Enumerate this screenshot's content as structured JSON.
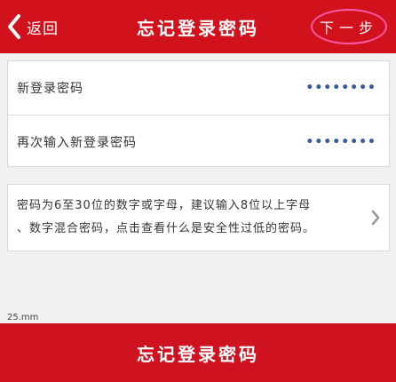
{
  "header": {
    "back_label": "返回",
    "title": "忘记登录密码",
    "next_label": "下一步"
  },
  "form": {
    "fields": [
      {
        "label": "新登录密码",
        "value": "••••••••"
      },
      {
        "label": "再次输入新登录密码",
        "value": "••••••••"
      }
    ]
  },
  "hint": {
    "line1": "密码为6至30位的数字或字母，建议输入8位以上字母",
    "line2": "、数字混合密码，点击查看什么是安全性过低的密码。"
  },
  "stray_text": "25.mm",
  "bottom_button": {
    "label": "忘记登录密码"
  },
  "colors": {
    "brand_red": "#d1121c",
    "highlight_circle": "#ff5aa8"
  },
  "icons": {
    "back": "chevron-left-icon",
    "hint_arrow": "chevron-right-icon"
  }
}
